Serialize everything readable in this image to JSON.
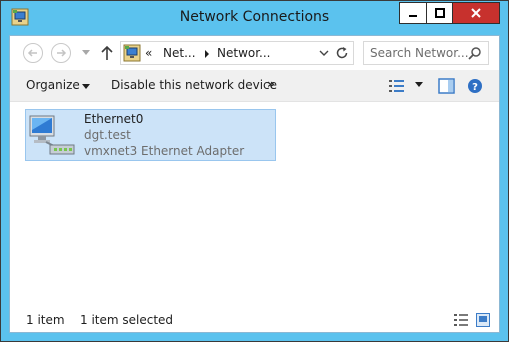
{
  "window": {
    "title": "Network Connections",
    "accent_color": "#5bc2ee",
    "close_color": "#c7312d",
    "icons": {
      "app": "network-connections-icon",
      "minimize": "minimize-icon",
      "maximize": "maximize-icon",
      "close": "close-icon"
    }
  },
  "nav": {
    "icons": [
      "back-arrow-icon",
      "forward-arrow-icon",
      "recent-locations-chevron-icon",
      "up-arrow-icon"
    ]
  },
  "address": {
    "overflow": "«",
    "crumbs": [
      "Net...",
      "Networ..."
    ],
    "icons": [
      "control-panel-icon",
      "breadcrumb-separator-icon",
      "dropdown-arrow-icon",
      "refresh-icon"
    ]
  },
  "search": {
    "placeholder": "Search Networ...",
    "icon": "search-icon"
  },
  "toolbar": {
    "organize_label": "Organize",
    "disable_label": "Disable this network device",
    "more_label": "»",
    "icons": [
      "change-view-icon",
      "view-options-dropdown-icon",
      "preview-pane-icon",
      "help-icon"
    ]
  },
  "items": [
    {
      "name": "Ethernet0",
      "network": "dgt.test",
      "device": "vmxnet3 Ethernet Adapter",
      "icon": "network-adapter-icon",
      "selected": true
    }
  ],
  "status": {
    "count": "1 item",
    "selected": "1 item selected",
    "icons": [
      "details-view-icon",
      "large-icons-view-icon"
    ]
  }
}
